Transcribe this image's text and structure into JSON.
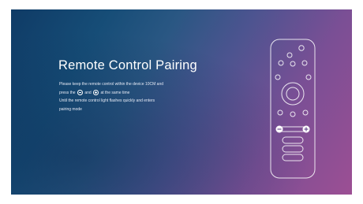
{
  "pairing": {
    "title": "Remote Control Pairing",
    "line1": "Please keep the remote control within the device 10CM and",
    "line2_before": "press the",
    "line2_middle": "and",
    "line2_after": "at the same time",
    "line3": "Until the remote control light flashes quickly and enters",
    "line4": "pairing mode"
  },
  "colors": {
    "gradient_start": "#0f3b66",
    "gradient_end": "#9c4f94",
    "text": "#ffffff"
  },
  "icons": {
    "minus_button": "minus-circle-icon",
    "plus_button": "plus-circle-icon",
    "remote": "remote-control-illustration"
  }
}
